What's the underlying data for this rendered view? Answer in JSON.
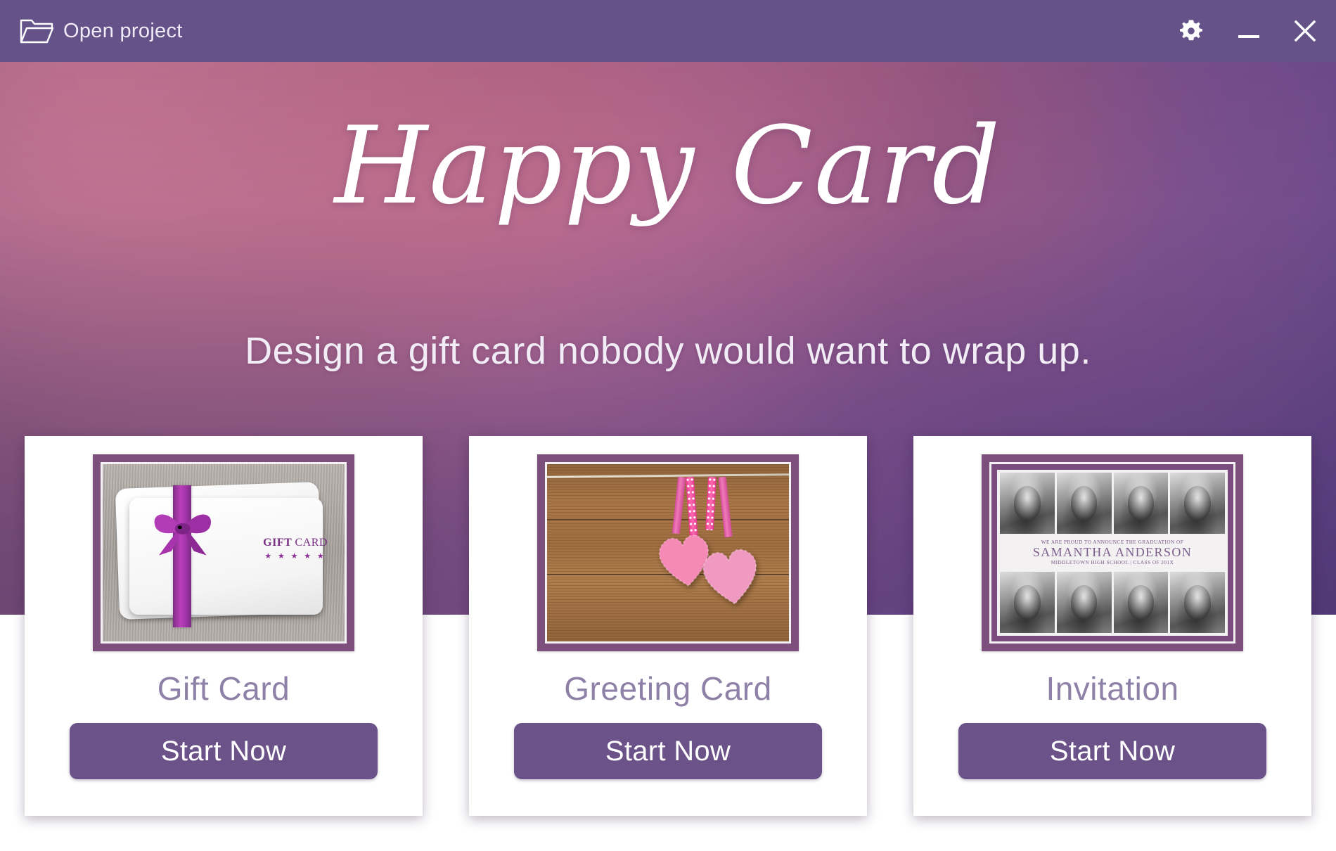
{
  "titlebar": {
    "open_project_label": "Open project",
    "open_project_icon": "open-folder-icon",
    "settings_icon": "gear-icon",
    "minimize_icon": "minimize-icon",
    "close_icon": "close-icon",
    "background_color": "#655289"
  },
  "hero": {
    "title": "Happy Card",
    "tagline": "Design a gift card nobody would want to wrap up.",
    "title_color": "#ffffff",
    "background_colors": [
      "#b3708f",
      "#a96a94",
      "#8b5a99",
      "#4e3a78"
    ]
  },
  "cards": [
    {
      "id": "gift-card",
      "label": "Gift Card",
      "button_label": "Start Now",
      "thumbnail": {
        "art": "gift-card-with-purple-bow",
        "frame_color": "#7c4f7c",
        "overlay_title": "GIFT CARD",
        "overlay_title_bold": "GIFT",
        "overlay_title_thin": "CARD",
        "overlay_stars": "★ ★ ★ ★ ★",
        "accent_color": "#7a2d84"
      }
    },
    {
      "id": "greeting-card",
      "label": "Greeting Card",
      "button_label": "Start Now",
      "thumbnail": {
        "art": "pink-knitted-hearts-on-wood",
        "frame_color": "#7c4f7c",
        "accent_color": "#e9368c"
      }
    },
    {
      "id": "invitation",
      "label": "Invitation",
      "button_label": "Start Now",
      "thumbnail": {
        "art": "graduation-photo-collage",
        "frame_color": "#7b4a7e",
        "announce_line": "WE ARE PROUD TO ANNOUNCE THE GRADUATION OF",
        "name": "SAMANTHA ANDERSON",
        "school_line": "MIDDLETOWN HIGH SCHOOL | CLASS OF 201X",
        "photo_count": 8,
        "accent_color": "#6c4a7e"
      }
    }
  ],
  "theme": {
    "button_color": "#6b5288",
    "card_label_color": "#8e81a8",
    "card_background": "#ffffff",
    "page_background": "#ffffff"
  }
}
